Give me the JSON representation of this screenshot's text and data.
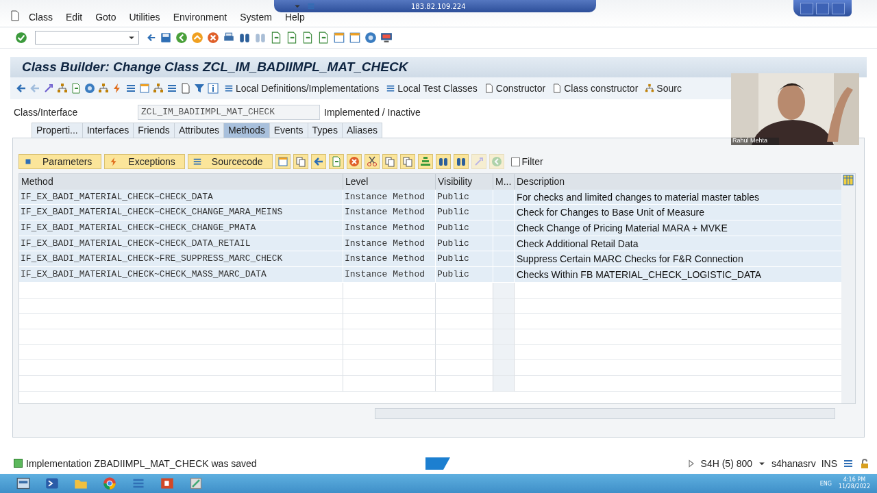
{
  "remote_bar": {
    "address": "183.82.109.224"
  },
  "menu": [
    "Class",
    "Edit",
    "Goto",
    "Utilities",
    "Environment",
    "System",
    "Help"
  ],
  "title": "Class Builder: Change Class ZCL_IM_BADIIMPL_MAT_CHECK",
  "app_toolbar": {
    "buttons": [
      "Local Definitions/Implementations",
      "Local Test Classes",
      "Constructor",
      "Class constructor",
      "Sourc"
    ]
  },
  "class_field": {
    "label": "Class/Interface",
    "value": "ZCL_IM_BADIIMPL_MAT_CHECK",
    "status": "Implemented / Inactive"
  },
  "tabs": [
    {
      "label": "Properti...",
      "selected": false
    },
    {
      "label": "Interfaces",
      "selected": false
    },
    {
      "label": "Friends",
      "selected": false
    },
    {
      "label": "Attributes",
      "selected": false
    },
    {
      "label": "Methods",
      "selected": true
    },
    {
      "label": "Events",
      "selected": false
    },
    {
      "label": "Types",
      "selected": false
    },
    {
      "label": "Aliases",
      "selected": false
    }
  ],
  "table_toolbar": {
    "buttons": [
      "Parameters",
      "Exceptions",
      "Sourcecode"
    ],
    "filter": {
      "label": "Filter",
      "checked": false
    }
  },
  "table": {
    "columns": [
      "Method",
      "Level",
      "Visibility",
      "M...",
      "Description"
    ],
    "rows": [
      [
        "IF_EX_BADI_MATERIAL_CHECK~CHECK_DATA",
        "Instance Method",
        "Public",
        "",
        "For checks and limited changes to material master tables"
      ],
      [
        "IF_EX_BADI_MATERIAL_CHECK~CHECK_CHANGE_MARA_MEINS",
        "Instance Method",
        "Public",
        "",
        "Check for Changes to Base Unit of Measure"
      ],
      [
        "IF_EX_BADI_MATERIAL_CHECK~CHECK_CHANGE_PMATA",
        "Instance Method",
        "Public",
        "",
        "Check Change of Pricing Material MARA + MVKE"
      ],
      [
        "IF_EX_BADI_MATERIAL_CHECK~CHECK_DATA_RETAIL",
        "Instance Method",
        "Public",
        "",
        "Check Additional Retail Data"
      ],
      [
        "IF_EX_BADI_MATERIAL_CHECK~FRE_SUPPRESS_MARC_CHECK",
        "Instance Method",
        "Public",
        "",
        "Suppress Certain MARC Checks for F&R Connection"
      ],
      [
        "IF_EX_BADI_MATERIAL_CHECK~CHECK_MASS_MARC_DATA",
        "Instance Method",
        "Public",
        "",
        "Checks Within FB MATERIAL_CHECK_LOGISTIC_DATA"
      ]
    ]
  },
  "status_bar": {
    "message": "Implementation ZBADIIMPL_MAT_CHECK was saved",
    "system": "S4H (5) 800",
    "server": "s4hanasrv",
    "mode": "INS"
  },
  "webcam": {
    "kind": "picture",
    "name": "Rahul Mehta"
  },
  "taskbar": {
    "language": "ENG",
    "time": "4:16 PM",
    "date": "11/28/2022"
  }
}
